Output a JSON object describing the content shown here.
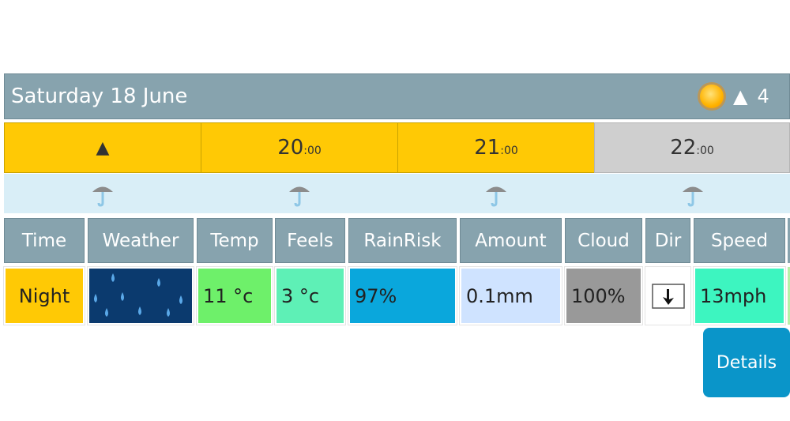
{
  "day_header": {
    "title": "Saturday 18 June",
    "sun_icon": "sun-icon",
    "sunrise_arrow": "▲",
    "partial_text": "4"
  },
  "time_row": [
    {
      "hour": "▲",
      "mins": "",
      "color": "#ffc905"
    },
    {
      "hour": "20",
      "mins": ":00",
      "color": "#ffc905"
    },
    {
      "hour": "21",
      "mins": ":00",
      "color": "#ffc905"
    },
    {
      "hour": "22",
      "mins": ":00",
      "color": "#cfcfcf"
    }
  ],
  "rain_icons": "umbrella-icon",
  "table": {
    "headers": [
      "Time",
      "Weather",
      "Temp",
      "Feels",
      "RainRisk",
      "Amount",
      "Cloud",
      "Dir",
      "Speed"
    ],
    "row": {
      "time": "Night",
      "weather": "rain-icon",
      "temp": "11 °c",
      "feels": "3 °c",
      "rainrisk": "97%",
      "amount": "0.1mm",
      "cloud": "100%",
      "dir": "arrow-south-icon",
      "speed": "13mph"
    },
    "colors": {
      "time": "#ffc905",
      "weather": "#0b3a6e",
      "temp": "#6ef06a",
      "feels": "#5ef0b6",
      "rainrisk": "#0aa7dc",
      "amount": "#cfe3ff",
      "cloud": "#999999",
      "dir": "#ffffff",
      "speed": "#3df5c0"
    }
  },
  "details_button": "Details"
}
